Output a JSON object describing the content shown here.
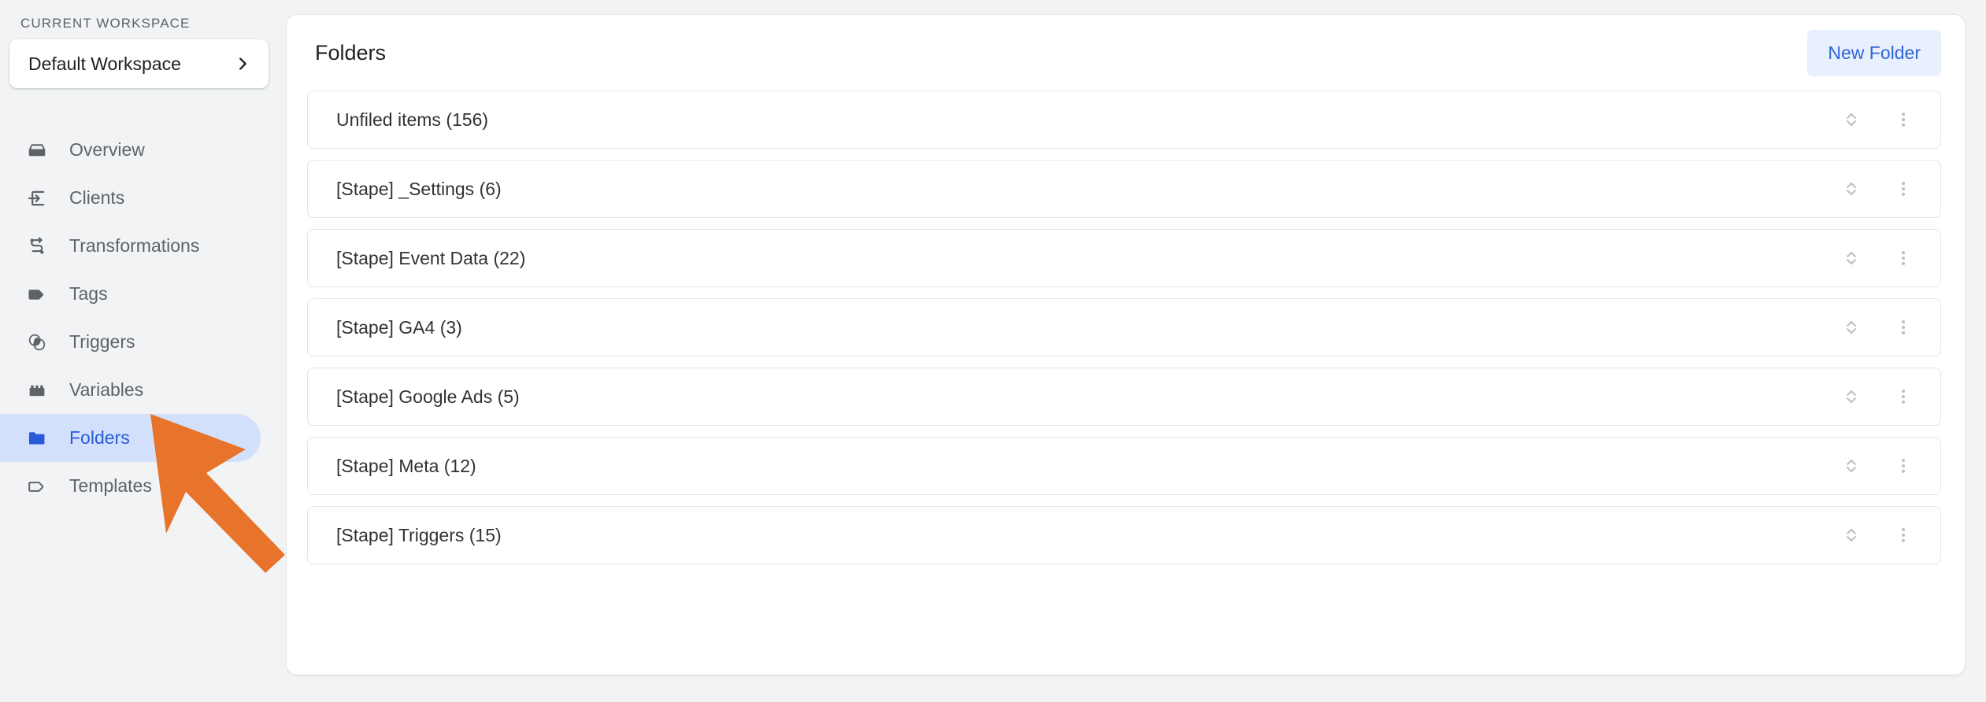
{
  "sidebar": {
    "workspace_section_label": "CURRENT WORKSPACE",
    "workspace_name": "Default Workspace",
    "workspace_chevron_icon": "chevron-right-icon",
    "items": [
      {
        "label": "Overview",
        "icon": "inbox-icon",
        "active": false
      },
      {
        "label": "Clients",
        "icon": "login-arrow-icon",
        "active": false
      },
      {
        "label": "Transformations",
        "icon": "transform-node-icon",
        "active": false
      },
      {
        "label": "Tags",
        "icon": "tag-filled-icon",
        "active": false
      },
      {
        "label": "Triggers",
        "icon": "venn-circles-icon",
        "active": false
      },
      {
        "label": "Variables",
        "icon": "brick-icon",
        "active": false
      },
      {
        "label": "Folders",
        "icon": "folder-filled-icon",
        "active": true
      },
      {
        "label": "Templates",
        "icon": "tag-outline-icon",
        "active": false
      }
    ]
  },
  "main": {
    "title": "Folders",
    "new_folder_label": "New Folder",
    "row_sort_icon": "sort-updown-icon",
    "row_menu_icon": "more-vertical-icon",
    "folders": [
      {
        "name": "Unfiled items (156)"
      },
      {
        "name": "[Stape] _Settings (6)"
      },
      {
        "name": "[Stape] Event Data (22)"
      },
      {
        "name": "[Stape] GA4 (3)"
      },
      {
        "name": "[Stape] Google Ads (5)"
      },
      {
        "name": "[Stape] Meta (12)"
      },
      {
        "name": "[Stape] Triggers (15)"
      }
    ]
  },
  "annotation": {
    "arrow_icon": "pointer-arrow-annotation",
    "arrow_color": "#E8742C"
  },
  "colors": {
    "page_background": "#f1f3f4",
    "panel_background": "#ffffff",
    "accent_blue": "#3066d6",
    "active_nav_background": "#d2e0fb",
    "active_nav_text": "#2a5bd7",
    "muted_text": "#5f6368",
    "row_border": "#e4e6e8",
    "icon_grey": "#bdc1c6"
  }
}
